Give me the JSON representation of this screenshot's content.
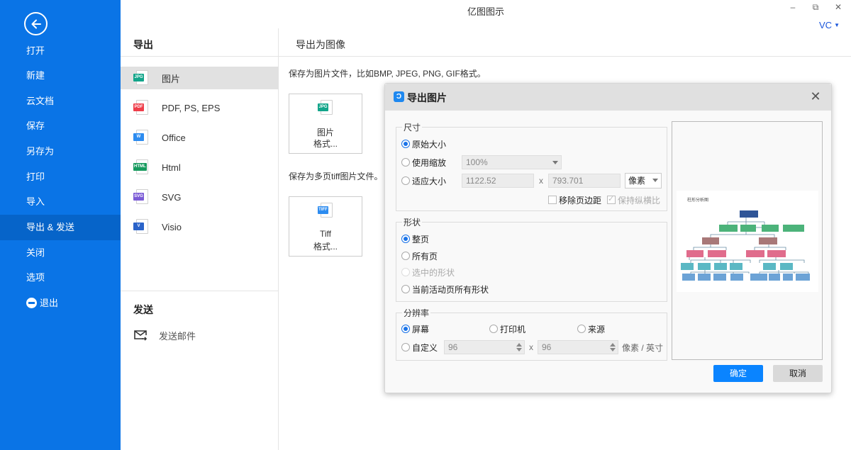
{
  "app": {
    "title": "亿图图示",
    "user": "VC",
    "window_controls": [
      "minimize",
      "restore",
      "close"
    ]
  },
  "sidebar": {
    "back_icon": "arrow-left-circle-icon",
    "items": [
      {
        "label": "打开",
        "active": false
      },
      {
        "label": "新建",
        "active": false
      },
      {
        "label": "云文档",
        "active": false
      },
      {
        "label": "保存",
        "active": false
      },
      {
        "label": "另存为",
        "active": false
      },
      {
        "label": "打印",
        "active": false
      },
      {
        "label": "导入",
        "active": false
      },
      {
        "label": "导出 & 发送",
        "active": true
      },
      {
        "label": "关闭",
        "active": false
      },
      {
        "label": "选项",
        "active": false
      },
      {
        "label": "退出",
        "active": false,
        "icon": "minus-circle-icon"
      }
    ]
  },
  "export_pane": {
    "header": "导出",
    "formats": [
      {
        "label": "图片",
        "tag": "JPG",
        "color": "#12a58a",
        "active": true
      },
      {
        "label": "PDF, PS, EPS",
        "tag": "PDF",
        "color": "#ef3e4a",
        "active": false
      },
      {
        "label": "Office",
        "tag": "W",
        "color": "#2d8cf0",
        "active": false
      },
      {
        "label": "Html",
        "tag": "HTML",
        "color": "#179a5e",
        "active": false
      },
      {
        "label": "SVG",
        "tag": "SVG",
        "color": "#7b5bd6",
        "active": false
      },
      {
        "label": "Visio",
        "tag": "V",
        "color": "#2a63c9",
        "active": false
      }
    ],
    "send_header": "发送",
    "send_items": [
      {
        "label": "发送邮件",
        "icon": "mail-send-icon"
      }
    ]
  },
  "main": {
    "title": "导出为图像",
    "image_desc": "保存为图片文件，比如BMP, JPEG, PNG, GIF格式。",
    "tiff_desc": "保存为多页tiff图片文件。",
    "cards": [
      {
        "tag": "JPG",
        "color": "#12a58a",
        "line1": "图片",
        "line2": "格式..."
      },
      {
        "tag": "TIFF",
        "color": "#2d8cf0",
        "line1": "Tiff",
        "line2": "格式..."
      }
    ]
  },
  "dialog": {
    "title": "导出图片",
    "size_group": {
      "legend": "尺寸",
      "options": [
        {
          "label": "原始大小",
          "checked": true
        },
        {
          "label": "使用缩放",
          "checked": false
        },
        {
          "label": "适应大小",
          "checked": false
        }
      ],
      "zoom_value": "100%",
      "width_value": "1122.52",
      "height_value": "793.701",
      "x_sep": "x",
      "unit": "像素",
      "remove_margin": {
        "label": "移除页边距",
        "checked": false
      },
      "keep_ratio": {
        "label": "保持纵横比",
        "checked": true,
        "disabled": true
      }
    },
    "shape_group": {
      "legend": "形状",
      "options": [
        {
          "label": "整页",
          "checked": true,
          "disabled": false
        },
        {
          "label": "所有页",
          "checked": false,
          "disabled": false
        },
        {
          "label": "选中的形状",
          "checked": false,
          "disabled": true
        },
        {
          "label": "当前活动页所有形状",
          "checked": false,
          "disabled": false
        }
      ]
    },
    "resolution_group": {
      "legend": "分辨率",
      "options": [
        {
          "label": "屏幕",
          "checked": true
        },
        {
          "label": "打印机",
          "checked": false
        },
        {
          "label": "来源",
          "checked": false
        },
        {
          "label": "自定义",
          "checked": false
        }
      ],
      "dpi_x": "96",
      "dpi_y": "96",
      "x_sep": "x",
      "unit": "像素 / 英寸"
    },
    "preview": {
      "diagram_title": "柱形分析图"
    },
    "ok_label": "确定",
    "cancel_label": "取消"
  }
}
